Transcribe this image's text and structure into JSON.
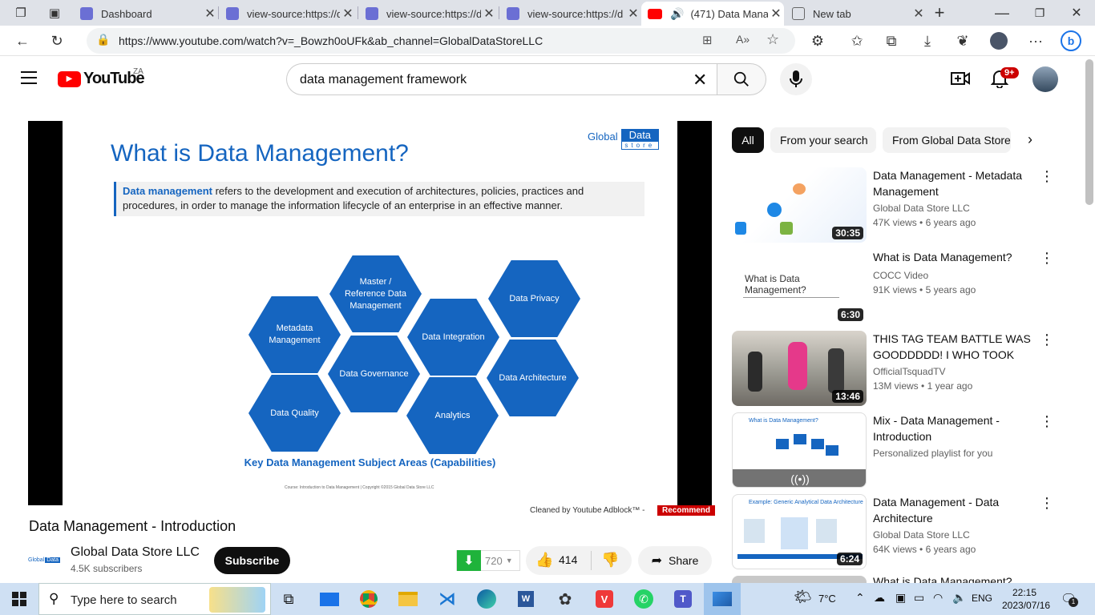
{
  "browser": {
    "tabs": [
      {
        "title": "Dashboard",
        "color": "#6b6fd4"
      },
      {
        "title": "view-source:https://d",
        "color": "#6b6fd4"
      },
      {
        "title": "view-source:https://d",
        "color": "#6b6fd4"
      },
      {
        "title": "view-source:https://d",
        "color": "#6b6fd4"
      },
      {
        "title": "(471) Data Mana",
        "color": "#ff0000"
      },
      {
        "title": "New tab",
        "color": "#888888"
      }
    ],
    "url": "https://www.youtube.com/watch?v=_Bowzh0oUFk&ab_channel=GlobalDataStoreLLC"
  },
  "youtube": {
    "logo_text": "YouTube",
    "country": "ZA",
    "search_value": "data management framework",
    "notif_count": "9+"
  },
  "slide": {
    "logo_word1": "Global",
    "logo_word2": "Data",
    "logo_word3": "store",
    "title": "What is Data Management?",
    "def_term": "Data management",
    "def_rest": " refers to the development and execution of architectures, policies, practices and procedures, in order to manage the information lifecycle of an enterprise in an effective manner.",
    "hexes": [
      "Master / Reference Data Management",
      "Data Privacy",
      "Metadata Management",
      "Data Integration",
      "Data Governance",
      "Data Architecture",
      "Data Quality",
      "Analytics"
    ],
    "caption": "Key Data Management Subject Areas (Capabilities)",
    "source": "Course: Introduction to Data Management | Copyright ©2015 Global Data Store LLC"
  },
  "adblock": {
    "text": "Cleaned by Youtube Adblock™ -",
    "button": "Recommend"
  },
  "video": {
    "title": "Data Management - Introduction",
    "channel": "Global Data Store LLC",
    "subscribers": "4.5K subscribers",
    "subscribe_label": "Subscribe",
    "dislikes_count": "720",
    "likes": "414",
    "share_label": "Share"
  },
  "chips": [
    "All",
    "From your search",
    "From Global Data Store"
  ],
  "recommendations": [
    {
      "title": "Data Management - Metadata Management",
      "channel": "Global Data Store LLC",
      "views": "47K views",
      "age": "6 years ago",
      "duration": "30:35"
    },
    {
      "title": "What is Data Management?",
      "channel": "COCC Video",
      "views": "91K views",
      "age": "5 years ago",
      "duration": "6:30",
      "thumb_text": "What is Data Management?"
    },
    {
      "title": "THIS TAG TEAM BATTLE WAS GOODDDDD! I WHO TOOK THE...",
      "channel": "OfficialTsquadTV",
      "views": "13M views",
      "age": "1 year ago",
      "duration": "13:46"
    },
    {
      "title": "Mix - Data Management - Introduction",
      "channel": "Personalized playlist for you",
      "thumb_text": "What is Data Management?"
    },
    {
      "title": "Data Management - Data Architecture",
      "channel": "Global Data Store LLC",
      "views": "64K views",
      "age": "6 years ago",
      "duration": "6:24",
      "thumb_text": "Example: Generic Analytical Data Architecture"
    },
    {
      "title": "What is Data Management?"
    }
  ],
  "taskbar": {
    "search_placeholder": "Type here to search",
    "weather": "7°C",
    "lang": "ENG",
    "time": "22:15",
    "date": "2023/07/16",
    "notif": "1"
  },
  "colors": {
    "yt_red": "#ff0000",
    "slide_blue": "#1565c0",
    "taskbar": "#cfe0f3"
  }
}
